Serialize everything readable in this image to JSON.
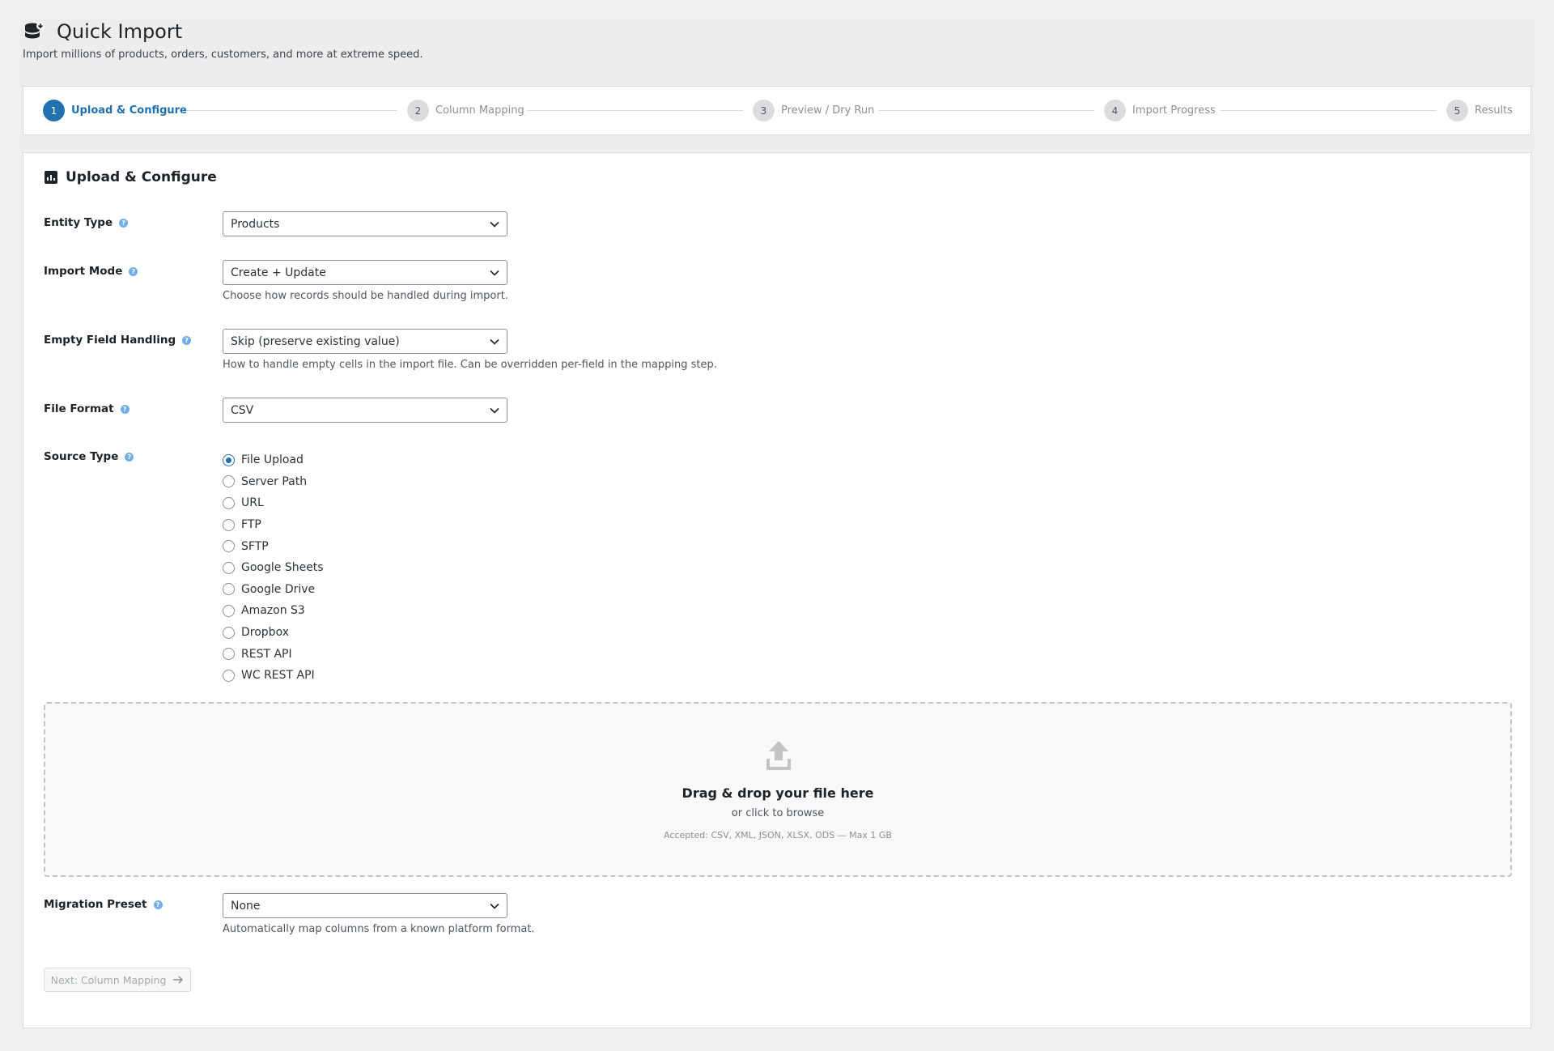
{
  "app": {
    "title": "Quick Import",
    "subtitle": "Import millions of products, orders, customers, and more at extreme speed."
  },
  "stepper": {
    "steps": [
      {
        "num": "1",
        "label": "Upload & Configure",
        "active": true
      },
      {
        "num": "2",
        "label": "Column Mapping",
        "active": false
      },
      {
        "num": "3",
        "label": "Preview / Dry Run",
        "active": false
      },
      {
        "num": "4",
        "label": "Import Progress",
        "active": false
      },
      {
        "num": "5",
        "label": "Results",
        "active": false
      }
    ]
  },
  "panel": {
    "title": "Upload & Configure",
    "entity_type": {
      "label": "Entity Type",
      "value": "Products"
    },
    "import_mode": {
      "label": "Import Mode",
      "value": "Create + Update",
      "desc": "Choose how records should be handled during import."
    },
    "empty_field": {
      "label": "Empty Field Handling",
      "value": "Skip (preserve existing value)",
      "desc": "How to handle empty cells in the import file. Can be overridden per-field in the mapping step."
    },
    "file_format": {
      "label": "File Format",
      "value": "CSV"
    },
    "source_type": {
      "label": "Source Type",
      "selected": "File Upload",
      "options": [
        "File Upload",
        "Server Path",
        "URL",
        "FTP",
        "SFTP",
        "Google Sheets",
        "Google Drive",
        "Amazon S3",
        "Dropbox",
        "REST API",
        "WC REST API"
      ]
    },
    "dropzone": {
      "title": "Drag & drop your file here",
      "sub": "or click to browse",
      "accepted": "Accepted: CSV, XML, JSON, XLSX, ODS — Max 1 GB"
    },
    "migration_preset": {
      "label": "Migration Preset",
      "value": "None",
      "desc": "Automatically map columns from a known platform format."
    },
    "next_button": "Next: Column Mapping"
  },
  "colors": {
    "accent": "#2271b1",
    "help": "#72aee6"
  }
}
